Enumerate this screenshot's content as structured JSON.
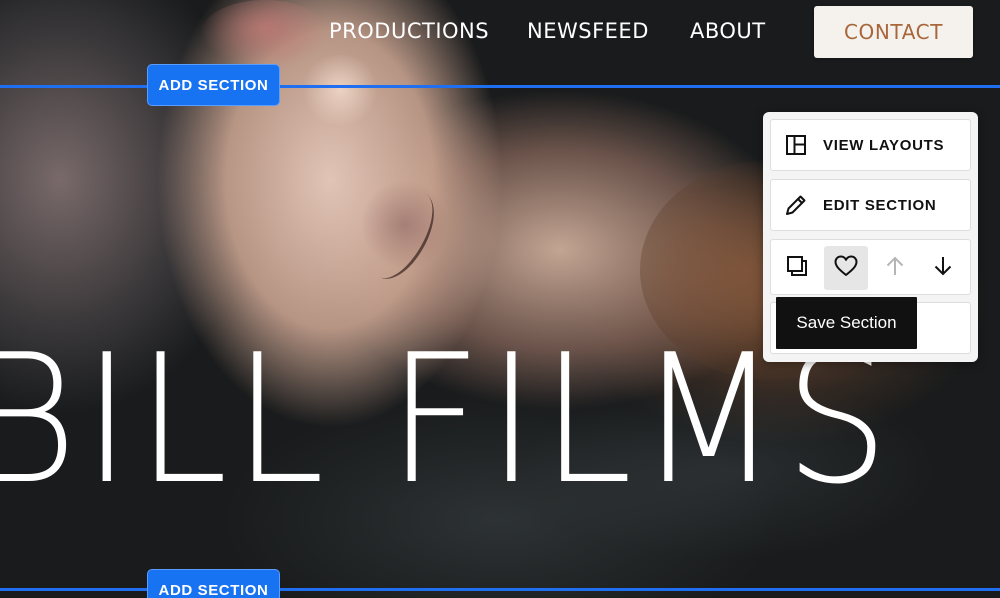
{
  "nav": {
    "links": [
      {
        "label": "PRODUCTIONS"
      },
      {
        "label": "NEWSFEED"
      },
      {
        "label": "ABOUT"
      }
    ],
    "contact_label": "CONTACT"
  },
  "editor": {
    "add_section_label": "ADD SECTION",
    "accent_color": "#1873f2",
    "panel": {
      "view_layouts_label": "VIEW LAYOUTS",
      "edit_section_label": "EDIT SECTION",
      "icons": [
        "duplicate-icon",
        "heart-icon",
        "arrow-up-icon",
        "arrow-down-icon"
      ],
      "tooltip": "Save Section"
    }
  },
  "hero": {
    "title": "BILL FILMS"
  },
  "colors": {
    "contact_text": "#a7673a",
    "contact_bg": "#f5f2ee"
  }
}
